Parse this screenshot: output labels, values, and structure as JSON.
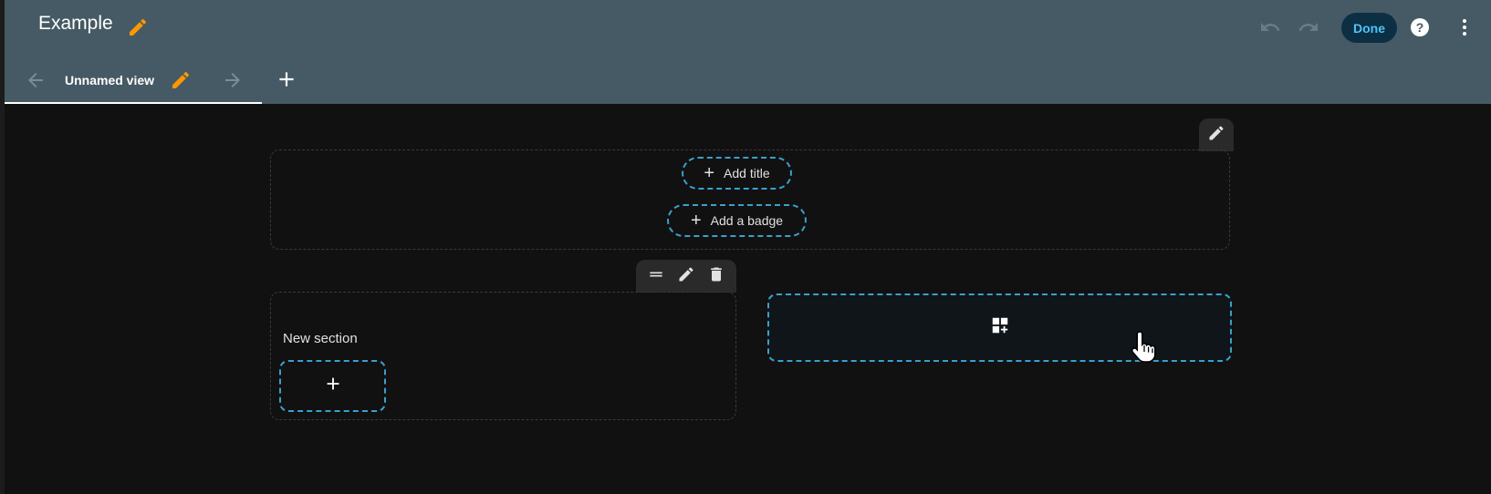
{
  "header": {
    "title": "Example",
    "done_label": "Done"
  },
  "tabs": [
    {
      "label": "Unnamed view",
      "active": true
    }
  ],
  "view_header": {
    "add_title_label": "Add title",
    "add_badge_label": "Add a badge"
  },
  "sections": [
    {
      "title": "New section"
    }
  ],
  "icons": {
    "title_edit": "pencil-icon",
    "undo": "undo-icon",
    "redo": "redo-icon",
    "help": "help-icon",
    "menu": "more-vertical-icon",
    "tab_prev": "arrow-left-icon",
    "tab_next": "arrow-right-icon",
    "tab_add": "plus-icon",
    "drag": "drag-handle-icon",
    "delete": "trash-icon",
    "add_section": "dashboard-add-icon",
    "cursor": "hand-pointer-icon"
  },
  "colors": {
    "header_bg": "#455a64",
    "accent_orange": "#ff9800",
    "dashed_blue": "#3aa0cc",
    "done_text": "#4fc3f7",
    "background": "#111111"
  }
}
